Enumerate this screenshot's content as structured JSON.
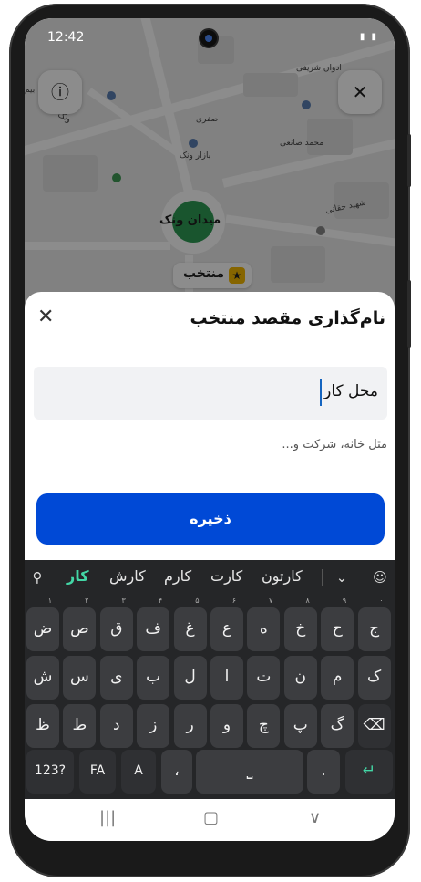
{
  "status": {
    "time": "12:42",
    "icons": "▮ ▮"
  },
  "map": {
    "labels": {
      "street1": "ادوان شریفی",
      "street2": "محمد صانعی",
      "street3": "شهید حقانی",
      "street4": "ونک",
      "market": "بازار ونک",
      "shop": "صفری",
      "square": "میدان ونک",
      "edge": "بیم"
    },
    "favorite_chip": "منتخب",
    "info_icon": "ⓘ",
    "close_icon": "✕"
  },
  "sheet": {
    "title": "نام‌گذاری مقصد منتخب",
    "close": "✕",
    "input_value": "محل کار",
    "helper": "مثل خانه، شرکت و...",
    "save": "ذخیره"
  },
  "keyboard": {
    "suggestions": [
      "کار",
      "کارش",
      "کارم",
      "کارت",
      "کارتون"
    ],
    "rows": [
      [
        {
          "k": "ج",
          "h": "۰"
        },
        {
          "k": "ح",
          "h": "۹"
        },
        {
          "k": "خ",
          "h": "۸"
        },
        {
          "k": "ه",
          "h": "۷"
        },
        {
          "k": "ع",
          "h": "۶"
        },
        {
          "k": "غ",
          "h": "۵"
        },
        {
          "k": "ف",
          "h": "۴"
        },
        {
          "k": "ق",
          "h": "۳"
        },
        {
          "k": "ص",
          "h": "۲"
        },
        {
          "k": "ض",
          "h": "۱"
        }
      ],
      [
        {
          "k": "ک"
        },
        {
          "k": "م"
        },
        {
          "k": "ن"
        },
        {
          "k": "ت"
        },
        {
          "k": "ا"
        },
        {
          "k": "ل"
        },
        {
          "k": "ب"
        },
        {
          "k": "ی"
        },
        {
          "k": "س"
        },
        {
          "k": "ش"
        }
      ],
      [
        {
          "k": "⌫"
        },
        {
          "k": "گ"
        },
        {
          "k": "پ"
        },
        {
          "k": "چ"
        },
        {
          "k": "و"
        },
        {
          "k": "ر"
        },
        {
          "k": "ز"
        },
        {
          "k": "د"
        },
        {
          "k": "ط"
        },
        {
          "k": "ظ"
        }
      ]
    ],
    "bottom": {
      "num": "123?",
      "lang": "FA",
      "comma": "،",
      "period": ".",
      "enter": "↵"
    }
  },
  "nav": {
    "recent": "|||",
    "home": "▢",
    "back": "∨"
  },
  "colors": {
    "accent": "#0049d6",
    "suggest": "#43d7a6"
  }
}
